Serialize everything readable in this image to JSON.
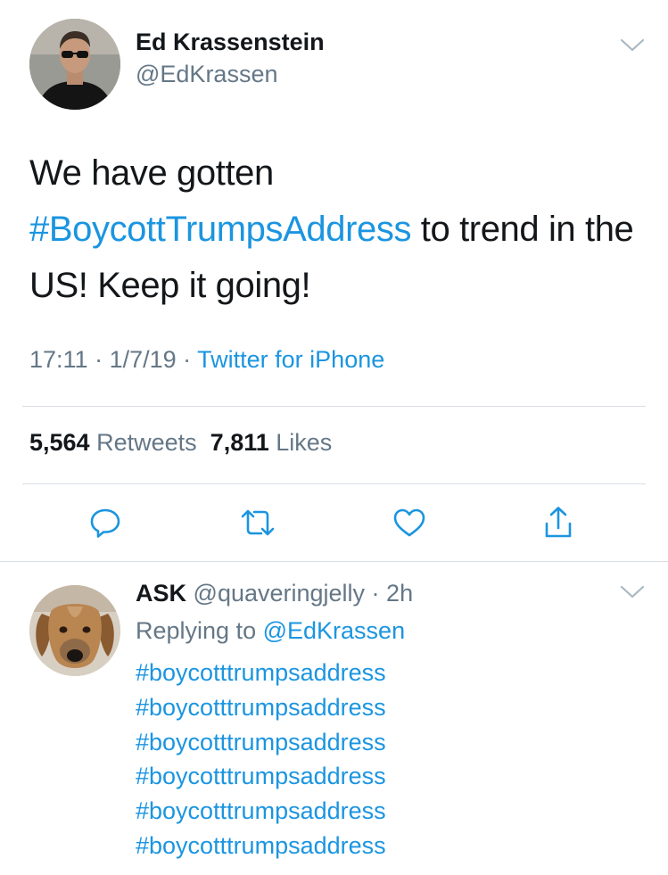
{
  "tweet": {
    "author": {
      "display_name": "Ed Krassenstein",
      "handle": "@EdKrassen",
      "avatar": "profile-photo"
    },
    "text": {
      "before": "We have gotten ",
      "hashtag": "#BoycottTrumpsAddress",
      "after": " to trend in the US!  Keep it going!"
    },
    "meta": {
      "time": "17:11",
      "date": "1/7/19",
      "separator": " · ",
      "source": "Twitter for iPhone"
    },
    "stats": {
      "retweets_count": "5,564",
      "retweets_label": "Retweets",
      "likes_count": "7,811",
      "likes_label": "Likes"
    },
    "actions": [
      "reply-icon",
      "retweet-icon",
      "like-icon",
      "share-icon"
    ]
  },
  "reply": {
    "author": {
      "display_name": "ASK",
      "handle": "@quaveringjelly",
      "time": "2h",
      "avatar": "dog-photo"
    },
    "replying_to_label": "Replying to",
    "replying_to_handle": "@EdKrassen",
    "hashtags": [
      "#boycotttrumpsaddress",
      "#boycotttrumpsaddress",
      "#boycotttrumpsaddress",
      "#boycotttrumpsaddress",
      "#boycotttrumpsaddress",
      "#boycotttrumpsaddress"
    ]
  },
  "colors": {
    "text": "#14171a",
    "secondary": "#657786",
    "link": "#1b95e0",
    "divider": "#d9dee3",
    "icon": "#1b95e0"
  }
}
